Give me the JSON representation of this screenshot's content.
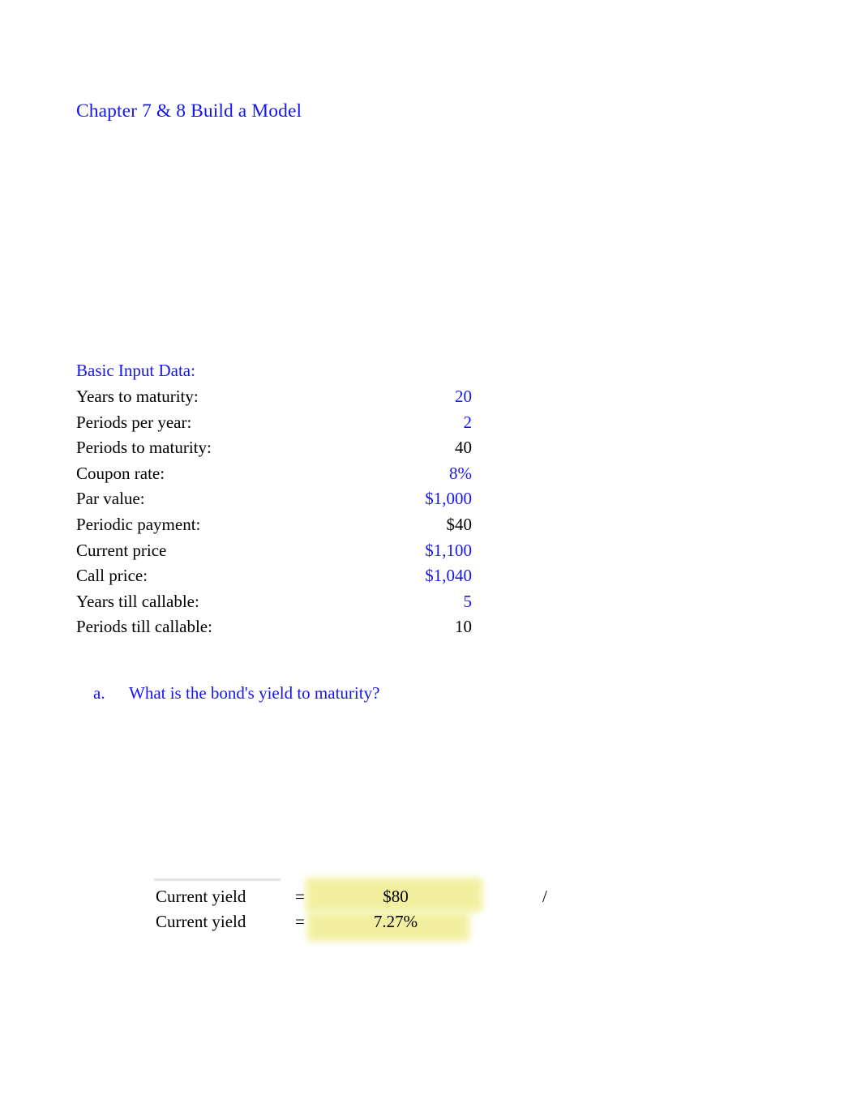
{
  "document": {
    "title": "Chapter 7 & 8 Build a Model",
    "page_background": "#ffffff",
    "input_color": "#1616ee",
    "calculated_color": "#000000",
    "highlight_color": "#f2f0a0"
  },
  "basic_input": {
    "header": "Basic Input Data:",
    "rows": [
      {
        "label": "Years to maturity:",
        "value": "20",
        "kind": "input"
      },
      {
        "label": "Periods per year:",
        "value": "2",
        "kind": "input"
      },
      {
        "label": "Periods to maturity:",
        "value": "40",
        "kind": "calc"
      },
      {
        "label": "Coupon rate:",
        "value": "8%",
        "kind": "input"
      },
      {
        "label": "Par value:",
        "value": "$1,000",
        "kind": "input"
      },
      {
        "label": "Periodic payment:",
        "value": "$40",
        "kind": "calc"
      },
      {
        "label": "Current price",
        "value": "$1,100",
        "kind": "input"
      },
      {
        "label": "Call price:",
        "value": "$1,040",
        "kind": "input"
      },
      {
        "label": "Years till callable:",
        "value": "5",
        "kind": "input"
      },
      {
        "label": "Periods till callable:",
        "value": "10",
        "kind": "calc"
      }
    ]
  },
  "questions": [
    {
      "marker": "a.",
      "text": "What is the bond's yield to maturity?"
    }
  ],
  "current_yield_block": {
    "rows": [
      {
        "label": "Current yield",
        "equals": "=",
        "value": "$80",
        "highlighted": true,
        "trailing_operator": "/"
      },
      {
        "label": "Current yield",
        "equals": "=",
        "value": "7.27%",
        "highlighted": true,
        "trailing_operator": ""
      }
    ]
  }
}
